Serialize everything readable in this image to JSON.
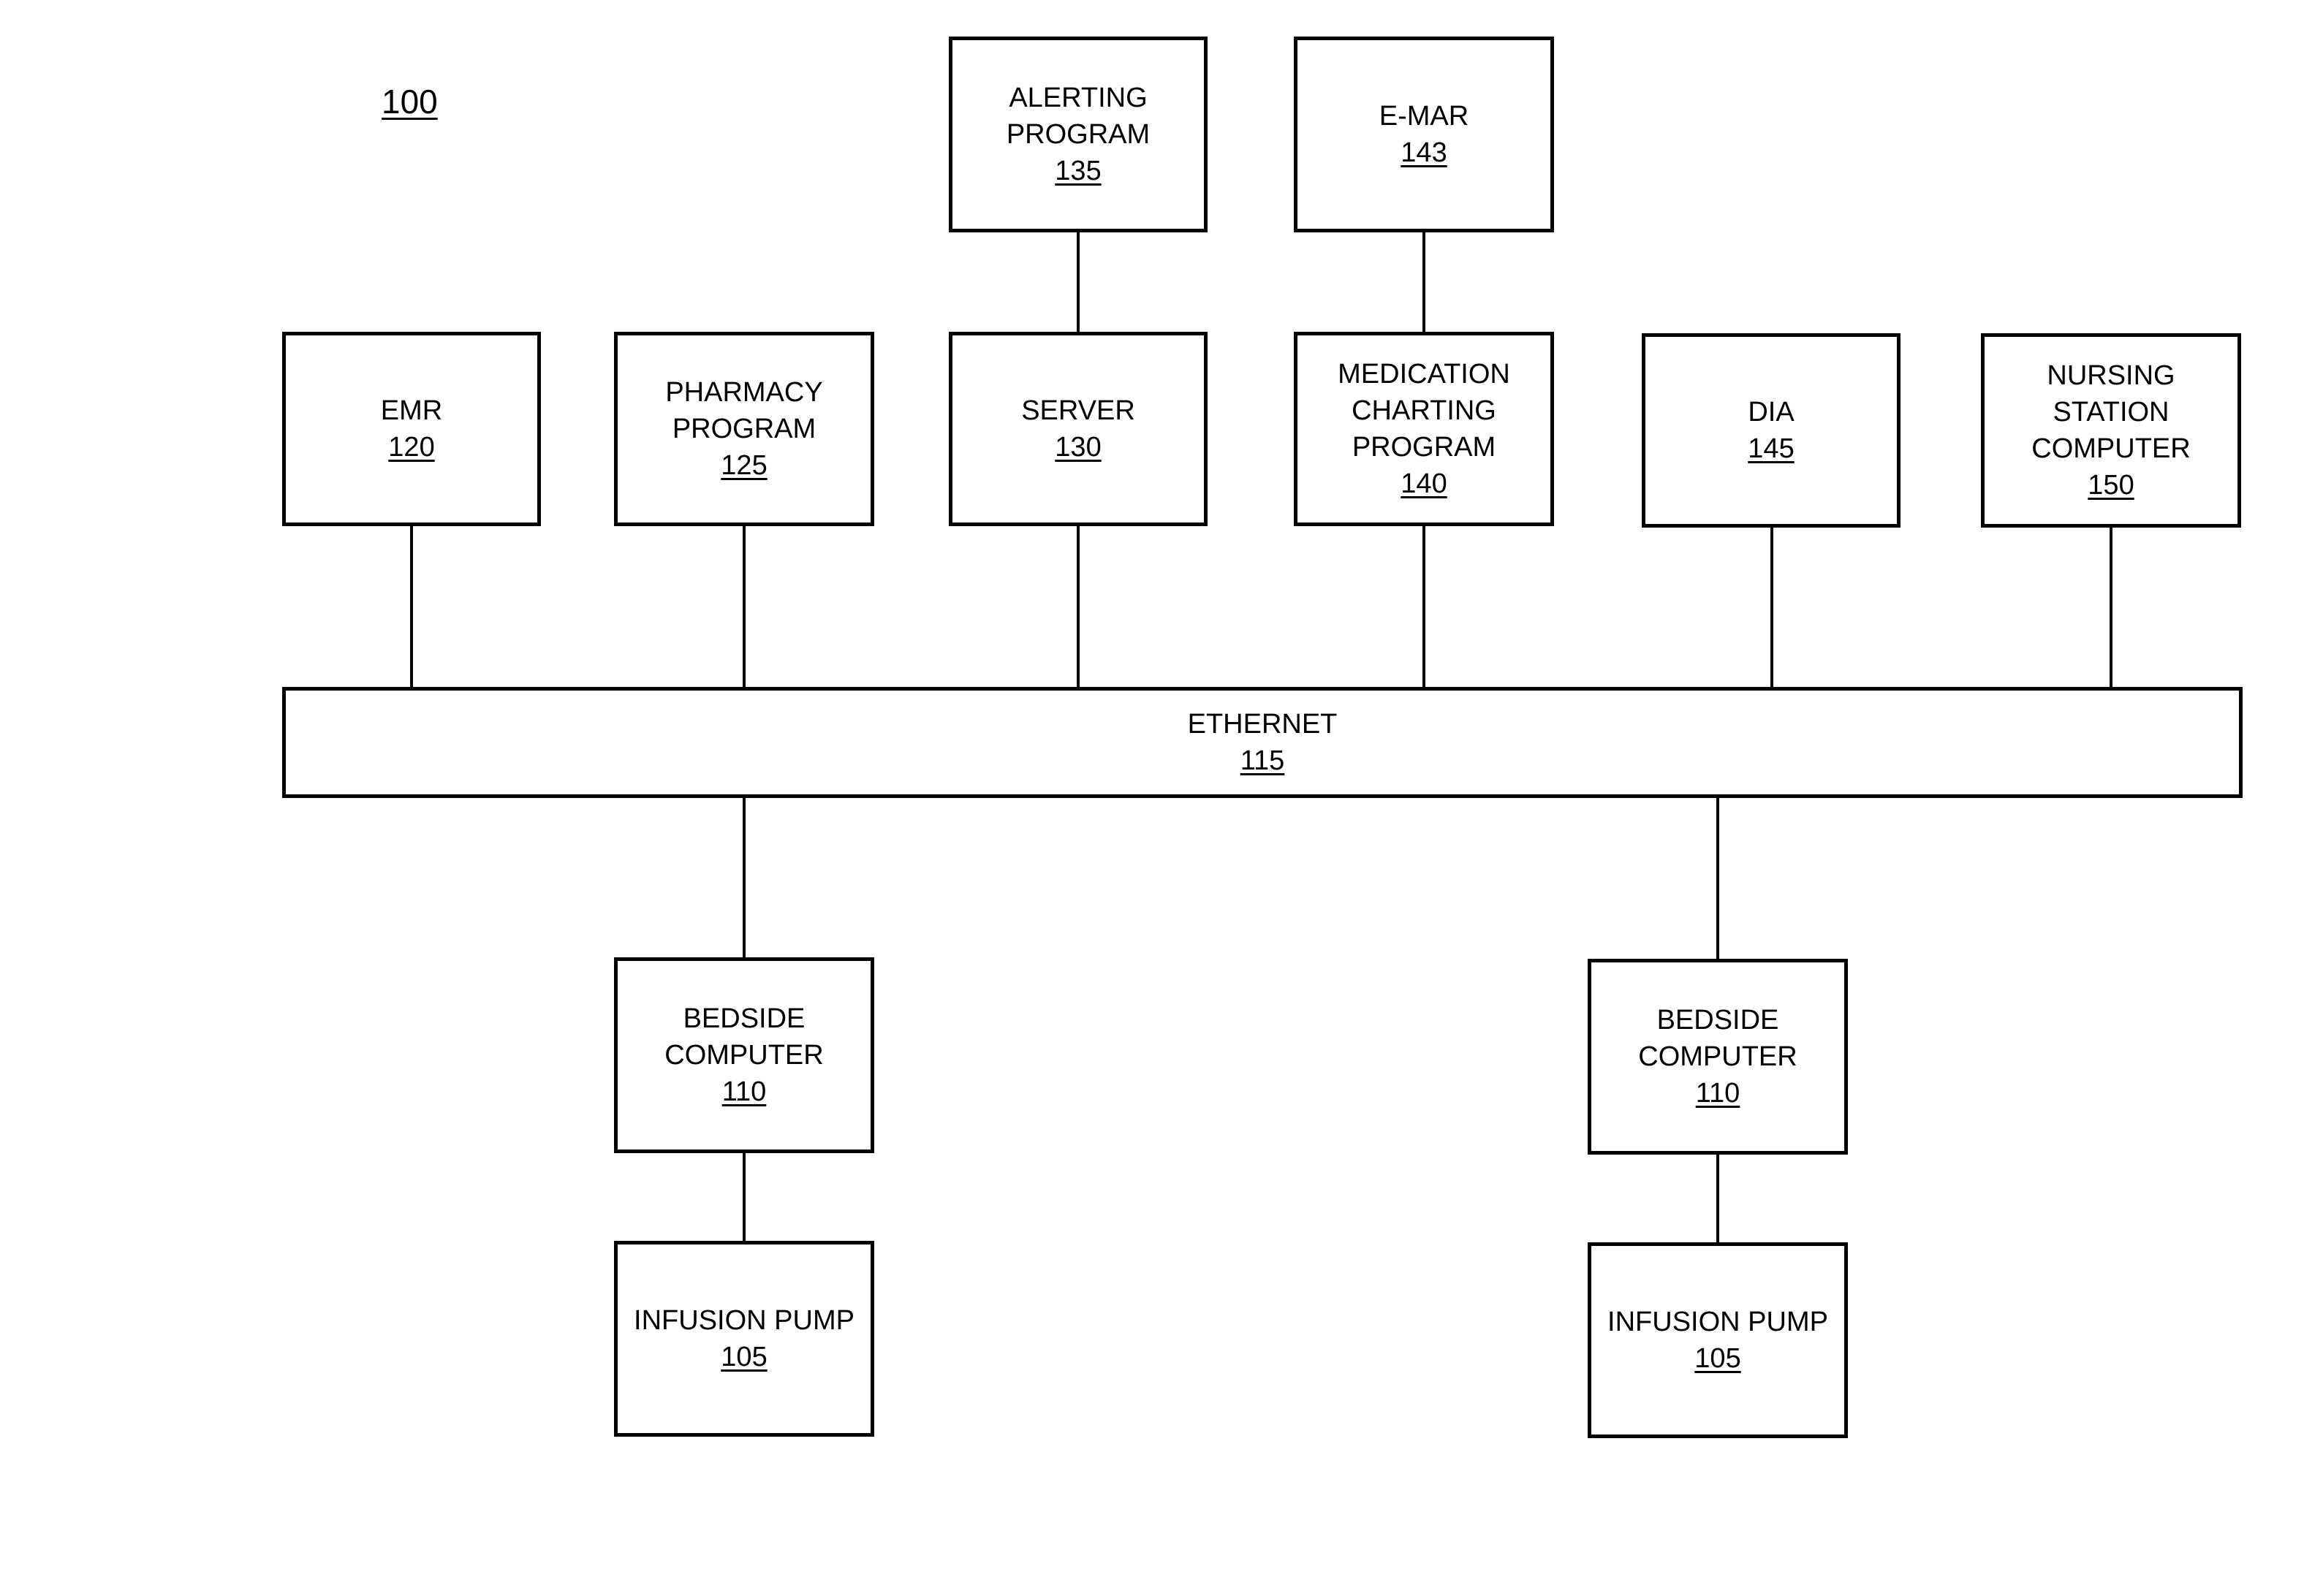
{
  "figure": {
    "label": "100"
  },
  "nodes": {
    "alerting": {
      "name": "ALERTING\nPROGRAM",
      "ref": "135"
    },
    "emar": {
      "name": "E-MAR",
      "ref": "143"
    },
    "emr": {
      "name": "EMR",
      "ref": "120"
    },
    "pharmacy": {
      "name": "PHARMACY\nPROGRAM",
      "ref": "125"
    },
    "server": {
      "name": "SERVER",
      "ref": "130"
    },
    "medication": {
      "name": "MEDICATION\nCHARTING\nPROGRAM",
      "ref": "140"
    },
    "dia": {
      "name": "DIA",
      "ref": "145"
    },
    "nursing": {
      "name": "NURSING\nSTATION\nCOMPUTER",
      "ref": "150"
    },
    "ethernet": {
      "name": "ETHERNET",
      "ref": "115"
    },
    "bedside_left": {
      "name": "BEDSIDE\nCOMPUTER",
      "ref": "110"
    },
    "pump_left": {
      "name": "INFUSION PUMP",
      "ref": "105"
    },
    "bedside_right": {
      "name": "BEDSIDE\nCOMPUTER",
      "ref": "110"
    },
    "pump_right": {
      "name": "INFUSION PUMP",
      "ref": "105"
    }
  },
  "connections": [
    [
      "alerting",
      "server"
    ],
    [
      "emar",
      "medication"
    ],
    [
      "emr",
      "ethernet"
    ],
    [
      "pharmacy",
      "ethernet"
    ],
    [
      "server",
      "ethernet"
    ],
    [
      "medication",
      "ethernet"
    ],
    [
      "dia",
      "ethernet"
    ],
    [
      "nursing",
      "ethernet"
    ],
    [
      "ethernet",
      "bedside_left"
    ],
    [
      "ethernet",
      "bedside_right"
    ],
    [
      "bedside_left",
      "pump_left"
    ],
    [
      "bedside_right",
      "pump_right"
    ]
  ]
}
